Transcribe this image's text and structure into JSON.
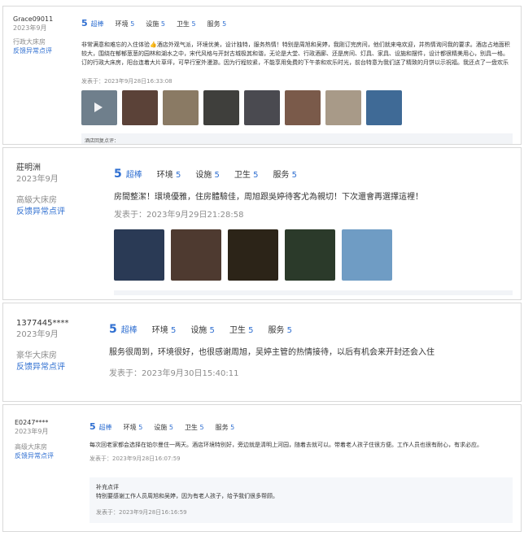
{
  "reviews": [
    {
      "user": "Grace09011",
      "date": "2023年9月",
      "room": "行政大床房",
      "report": "反馈异常点评",
      "score": "5",
      "score_word": "超棒",
      "subscores": [
        {
          "label": "环境",
          "value": "5"
        },
        {
          "label": "设施",
          "value": "5"
        },
        {
          "label": "卫生",
          "value": "5"
        },
        {
          "label": "服务",
          "value": "5"
        }
      ],
      "content": "非常满意和难忘的入住体验👍酒店外观气派，环境优美，设计独特，服务热情！特别是周旭和吴婷，我刚订完房间，他们就来电欢迎，并热情询问我的要求。酒店占地面积较大，围绕在郁郁葱葱的园林和湖水之中，宋代风格与开封古城极其和谐，无论是大堂、行政酒廊、还是房间、灯具、家具、设施和摆件，设计都很精美用心，别具一格。订的行政大床房，阳台连着大片草坪，可早行室外漫游。因为行程较紧，不能享用免费的下午茶和欢乐时光，前台特意为我们送了精致的月饼以示祝福。我还点了一盘欢乐时光的小食和葡萄酒送到房间，房间还配了水果和月饼😊",
      "time": "发表于：2023年9月28日16:33:08",
      "reply_hint": "酒店回复点评："
    },
    {
      "user": "莊明洲",
      "date": "2023年9月",
      "room": "高級大床房",
      "report": "反馈异常点评",
      "score": "5",
      "score_word": "超棒",
      "subscores": [
        {
          "label": "环境",
          "value": "5"
        },
        {
          "label": "设施",
          "value": "5"
        },
        {
          "label": "卫生",
          "value": "5"
        },
        {
          "label": "服务",
          "value": "5"
        }
      ],
      "content": "房間整潔！環境優雅，住房體驗佳，周旭跟吳婷待客尤為親切！下次還會再選擇這裡！",
      "time": "发表于：2023年9月29日21:28:58"
    },
    {
      "user": "1377445****",
      "date": "2023年9月",
      "room": "豪华大床房",
      "report": "反馈异常点评",
      "score": "5",
      "score_word": "超棒",
      "subscores": [
        {
          "label": "环境",
          "value": "5"
        },
        {
          "label": "设施",
          "value": "5"
        },
        {
          "label": "卫生",
          "value": "5"
        },
        {
          "label": "服务",
          "value": "5"
        }
      ],
      "content": "服务很周到，环境很好，也很感谢周旭，吴婷主管的热情接待，以后有机会来开封还会入住",
      "time": "发表于：2023年9月30日15:40:11"
    },
    {
      "user": "E0247****",
      "date": "2023年9月",
      "room": "高级大床房",
      "report": "反馈异常点评",
      "score": "5",
      "score_word": "超棒",
      "subscores": [
        {
          "label": "环境",
          "value": "5"
        },
        {
          "label": "设施",
          "value": "5"
        },
        {
          "label": "卫生",
          "value": "5"
        },
        {
          "label": "服务",
          "value": "5"
        }
      ],
      "content": "每次回老家都会选择在铂尔曼住一两天。酒店环境特别好，旁边就是清明上河园，随着去就可以。带着老人孩子住很方便。工作人员也很有耐心，有求必应。",
      "time": "发表于：2023年9月28日16:07:59",
      "supplement": {
        "title": "补充点评",
        "text": "特别要感谢工作人员周旭和吴婷，因为有老人孩子，给予我们很多帮顾。",
        "time": "发表于：2023年9月28日16:16:59"
      }
    }
  ],
  "photo_colors": {
    "r1": [
      "#6f7f8c",
      "#5b4238",
      "#8a7a64",
      "#3f3f3c",
      "#4a4a50",
      "#7a5a4a",
      "#a89a88",
      "#3f6a96"
    ],
    "r2": [
      "#2a3a55",
      "#4e3a30",
      "#2c2418",
      "#2b3a2a",
      "#6f9cc4"
    ]
  }
}
